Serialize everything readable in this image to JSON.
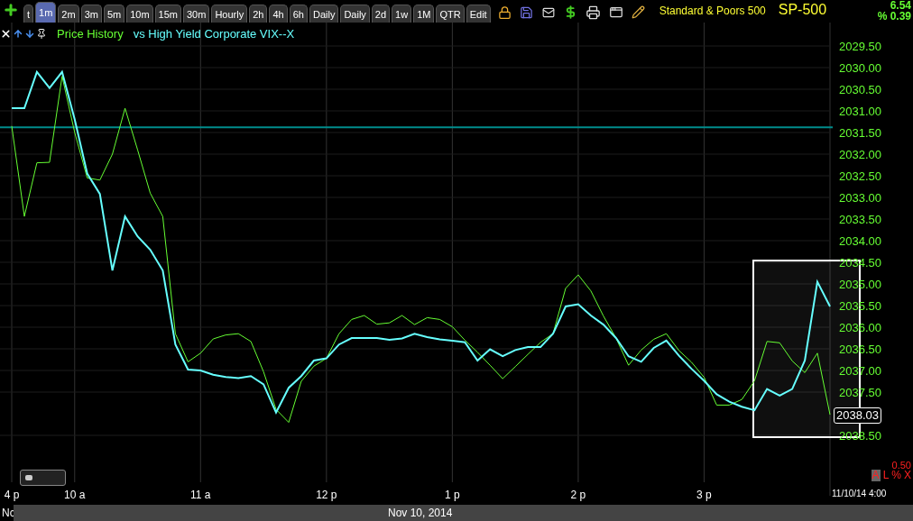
{
  "toolbar": {
    "tabs": [
      {
        "label": "t",
        "selected": false
      },
      {
        "label": "1m",
        "selected": true
      },
      {
        "label": "2m",
        "selected": false
      },
      {
        "label": "3m",
        "selected": false
      },
      {
        "label": "5m",
        "selected": false
      },
      {
        "label": "10m",
        "selected": false
      },
      {
        "label": "15m",
        "selected": false
      },
      {
        "label": "30m",
        "selected": false
      },
      {
        "label": "Hourly",
        "selected": false
      },
      {
        "label": "2h",
        "selected": false
      },
      {
        "label": "4h",
        "selected": false
      },
      {
        "label": "6h",
        "selected": false
      },
      {
        "label": "Daily",
        "selected": false
      },
      {
        "label": "Daily",
        "selected": false
      },
      {
        "label": "2d",
        "selected": false
      },
      {
        "label": "1w",
        "selected": false
      },
      {
        "label": "1M",
        "selected": false
      },
      {
        "label": "QTR",
        "selected": false
      },
      {
        "label": "Edit",
        "selected": false
      }
    ],
    "title": "Standard & Poors 500",
    "symbol": "SP-500",
    "change": "6.54",
    "change_percent": "% 0.39"
  },
  "chart": {
    "chart_data": {
      "type": "line",
      "grid": true,
      "ylim": [
        2039.9,
        2029.0
      ],
      "categories": [
        "4 p",
        null,
        null,
        null,
        null,
        "10 a",
        null,
        null,
        null,
        null,
        null,
        null,
        null,
        null,
        null,
        "11 a",
        null,
        null,
        null,
        null,
        null,
        null,
        null,
        null,
        null,
        "12 p",
        null,
        null,
        null,
        null,
        null,
        null,
        null,
        null,
        null,
        "1 p",
        null,
        null,
        null,
        null,
        null,
        null,
        null,
        null,
        null,
        "2 p",
        null,
        null,
        null,
        null,
        null,
        null,
        null,
        null,
        null,
        "3 p",
        null,
        null,
        null,
        null,
        null,
        null,
        null,
        null,
        null,
        null
      ],
      "yticks": [
        {
          "value": 2029.5,
          "label": "2029.50"
        },
        {
          "value": 2030,
          "label": "2030.00"
        },
        {
          "value": 2030.5,
          "label": "2030.50"
        },
        {
          "value": 2031,
          "label": "2031.00"
        },
        {
          "value": 2031.5,
          "label": "2031.50"
        },
        {
          "value": 2032,
          "label": "2032.00"
        },
        {
          "value": 2032.5,
          "label": "2032.50"
        },
        {
          "value": 2033,
          "label": "2033.00"
        },
        {
          "value": 2033.5,
          "label": "2033.50"
        },
        {
          "value": 2034,
          "label": "2034.00"
        },
        {
          "value": 2034.5,
          "label": "2034.50"
        },
        {
          "value": 2035,
          "label": "2035.00"
        },
        {
          "value": 2035.5,
          "label": "2035.50"
        },
        {
          "value": 2036,
          "label": "2036.00"
        },
        {
          "value": 2036.5,
          "label": "2036.50"
        },
        {
          "value": 2037,
          "label": "2037.00"
        },
        {
          "value": 2037.5,
          "label": "2037.50"
        },
        {
          "value": 2038.5,
          "label": "2038.50"
        }
      ],
      "series": [
        {
          "name": "Price History",
          "color": "#66ff33",
          "values": [
            2031.35,
            2033.44,
            2032.2,
            2032.19,
            2030.2,
            2031.5,
            2032.55,
            2032.6,
            2032.0,
            2030.94,
            2031.9,
            2032.9,
            2033.44,
            2036.15,
            2036.8,
            2036.6,
            2036.27,
            2036.18,
            2036.15,
            2036.33,
            2037.03,
            2037.9,
            2038.2,
            2037.25,
            2036.9,
            2036.72,
            2036.15,
            2035.82,
            2035.73,
            2035.93,
            2035.9,
            2035.73,
            2035.94,
            2035.78,
            2035.82,
            2035.99,
            2036.3,
            2036.58,
            2036.88,
            2037.19,
            2036.91,
            2036.63,
            2036.35,
            2036.15,
            2035.1,
            2034.79,
            2035.16,
            2035.74,
            2036.25,
            2036.88,
            2036.53,
            2036.28,
            2036.15,
            2036.54,
            2036.81,
            2037.16,
            2037.8,
            2037.8,
            2037.67,
            2037.24,
            2036.33,
            2036.36,
            2036.78,
            2037.05,
            2036.6,
            2038.02
          ]
        },
        {
          "name": "vs High Yield Corporate VIX--X",
          "color": "#66ffff",
          "values": [
            2030.94,
            2030.94,
            2030.1,
            2030.47,
            2030.1,
            2031.2,
            2032.45,
            2032.92,
            2034.69,
            2033.44,
            2033.9,
            2034.21,
            2034.69,
            2036.4,
            2036.98,
            2037.0,
            2037.1,
            2037.15,
            2037.18,
            2037.13,
            2037.32,
            2037.97,
            2037.4,
            2037.13,
            2036.77,
            2036.72,
            2036.4,
            2036.25,
            2036.25,
            2036.25,
            2036.29,
            2036.26,
            2036.15,
            2036.23,
            2036.28,
            2036.31,
            2036.35,
            2036.77,
            2036.51,
            2036.67,
            2036.53,
            2036.46,
            2036.46,
            2036.15,
            2035.52,
            2035.47,
            2035.73,
            2035.94,
            2036.25,
            2036.67,
            2036.8,
            2036.48,
            2036.31,
            2036.66,
            2036.96,
            2037.24,
            2037.55,
            2037.72,
            2037.84,
            2037.92,
            2037.43,
            2037.58,
            2037.43,
            2036.77,
            2034.95,
            2035.52
          ]
        }
      ],
      "ref_lines": [
        {
          "axis": "y",
          "value": 2031.38
        }
      ],
      "bands": [
        {
          "axis": "y",
          "from": 2034.46,
          "to": 2038.5
        }
      ]
    },
    "last_value": "2038.03",
    "scale_label": "0.50",
    "scale_buttons": [
      {
        "label": "A",
        "selected": true
      },
      {
        "label": "L",
        "selected": false
      },
      {
        "label": "%",
        "selected": false
      },
      {
        "label": "X",
        "selected": false
      }
    ],
    "end_time": "11/10/14 4:00"
  },
  "status_bar": {
    "left": "Nc",
    "date": "Nov 10, 2014"
  }
}
